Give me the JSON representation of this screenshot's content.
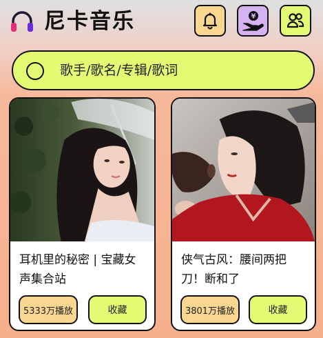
{
  "app": {
    "title": "尼卡音乐",
    "logo_icon": "headphones-icon"
  },
  "header": {
    "buttons": [
      {
        "icon": "bell-icon",
        "color": "#f9d790"
      },
      {
        "icon": "donate-hand-yen-icon",
        "color": "#d5b3f3"
      },
      {
        "icon": "users-icon",
        "color": "#e3fb73"
      }
    ]
  },
  "search": {
    "placeholder": "歌手/歌名/专辑/歌词",
    "icon": "search-circle-icon"
  },
  "playlists": [
    {
      "title": "耳机里的秘密 | 宝藏女声集合站",
      "plays": "5333万播放",
      "fav_label": "收藏"
    },
    {
      "title": "侠气古风：腰间两把刀！断和了",
      "plays": "3801万播放",
      "fav_label": "收藏"
    }
  ],
  "colors": {
    "accent_lime": "#e3fb73",
    "accent_orange": "#f9d790",
    "accent_purple": "#d5b3f3",
    "background": "#f6b08c"
  }
}
